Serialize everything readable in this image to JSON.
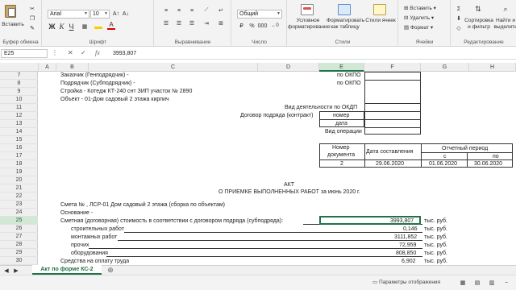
{
  "ribbon": {
    "clipboard": {
      "paste": "Вставить",
      "group": "Буфер обмена"
    },
    "font": {
      "name": "Arial",
      "size": "10",
      "bold": "Ж",
      "italic": "К",
      "underline": "Ч",
      "group": "Шрифт"
    },
    "alignment": {
      "group": "Выравнивание"
    },
    "number": {
      "format": "Общий",
      "group": "Число"
    },
    "styles": {
      "conditional": "Условное форматирование",
      "table": "Форматировать как таблицу",
      "cell_styles": "Стили ячеек",
      "group": "Стили"
    },
    "cells": {
      "insert": "Вставить",
      "delete": "Удалить",
      "format": "Формат",
      "group": "Ячейки"
    },
    "editing": {
      "sort": "Сортировка и фильтр",
      "find": "Найти и выделить",
      "group": "Редактирование"
    }
  },
  "formula_bar": {
    "name_box": "E25",
    "value": "3993,807"
  },
  "columns": [
    "A",
    "B",
    "C",
    "D",
    "E",
    "F",
    "G",
    "H"
  ],
  "rows": [
    "7",
    "8",
    "9",
    "10",
    "11",
    "12",
    "13",
    "14",
    "15",
    "16",
    "17",
    "18",
    "19",
    "20",
    "21",
    "22",
    "23",
    "24",
    "25",
    "26",
    "27",
    "28",
    "29",
    "30"
  ],
  "selected_row": "25",
  "selected_col": "E",
  "doc": {
    "customer": "Заказчик (Генподрядчик) -",
    "contractor": "Подрядчик (Субподрядчик) -",
    "construction": "Стройка - Котедж КТ-240 снт ЗИП участок № 2890",
    "object": "Объект - 01-Дом садовый 2 этажа кирпич",
    "okpo1": "по ОКПО",
    "okpo2": "по ОКПО",
    "okdp": "Вид деятельности по ОКДП",
    "contract": "Договор подряда (контракт)",
    "number": "номер",
    "date": "дата",
    "operation": "Вид операции",
    "doc_number_h1": "Номер",
    "doc_number_h2": "документа",
    "date_compiled": "Дата составления",
    "report_period": "Отчетный период",
    "period_from": "с",
    "period_to": "по",
    "doc_no": "2",
    "doc_date": "29.06.2020",
    "from_date": "01.06.2020",
    "to_date": "30.06.2020",
    "act": "АКТ",
    "act_title": "О ПРИЕМКЕ ВЫПОЛНЕННЫХ РАБОТ за июнь 2020 г.",
    "estimate": "Смета № , ЛСР-01 Дом садовый 2 этажа (сборка по объектам)",
    "basis": "Основание -",
    "estimated_cost": "Сметная (договорная) стоимость в соответствии с договором подряда (субподряда):",
    "construction_works": "строительных работ",
    "assembly_works": "монтажных работ",
    "other": "прочих",
    "equipment": "оборудования",
    "payment": "Средства на оплату труда",
    "total": "3993,807",
    "v_construction": "0,146",
    "v_assembly": "3111,852",
    "v_other": "72,959",
    "v_equipment": "808,850",
    "v_payment": "6,902",
    "unit": "тыс. руб."
  },
  "sheet_tab": "Акт по форме КС-2",
  "status": {
    "display_settings": "Параметры отображения"
  }
}
